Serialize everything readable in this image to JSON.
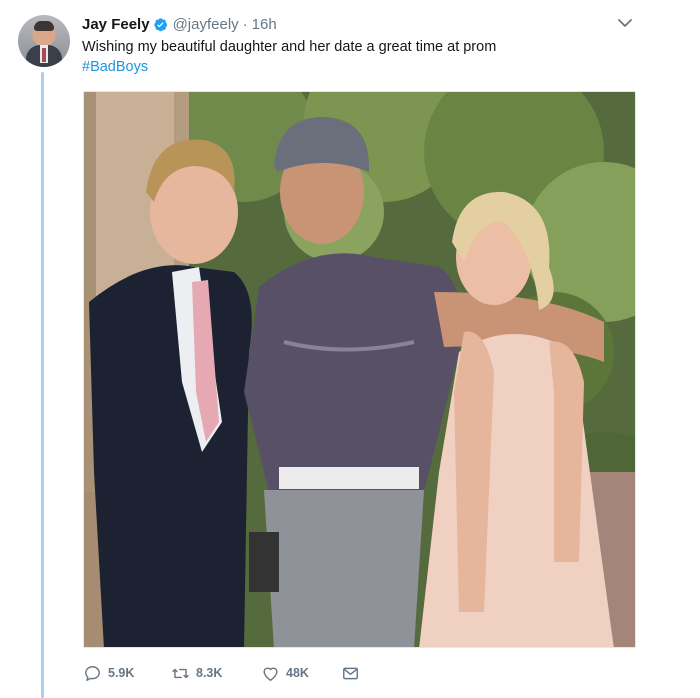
{
  "tweet": {
    "name": "Jay Feely",
    "handle": "@jayfeely",
    "separator": "·",
    "time": "16h",
    "text": "Wishing my beautiful daughter and her date a great time at prom",
    "hashtag": "#BadBoys",
    "photo_description": "Prom photo: young man in navy suit and pink tie, man in cap and purple polo holding a handgun, young woman in peach dress",
    "actions": {
      "replies": "5.9K",
      "retweets": "8.3K",
      "likes": "48K"
    }
  },
  "colors": {
    "accent": "#1da1f2",
    "link": "#1b95e0",
    "muted": "#657786",
    "thread_line": "#a3d2f5"
  },
  "icons": [
    "verified-badge-icon",
    "chevron-down-icon",
    "reply-icon",
    "retweet-icon",
    "like-icon",
    "message-icon"
  ]
}
